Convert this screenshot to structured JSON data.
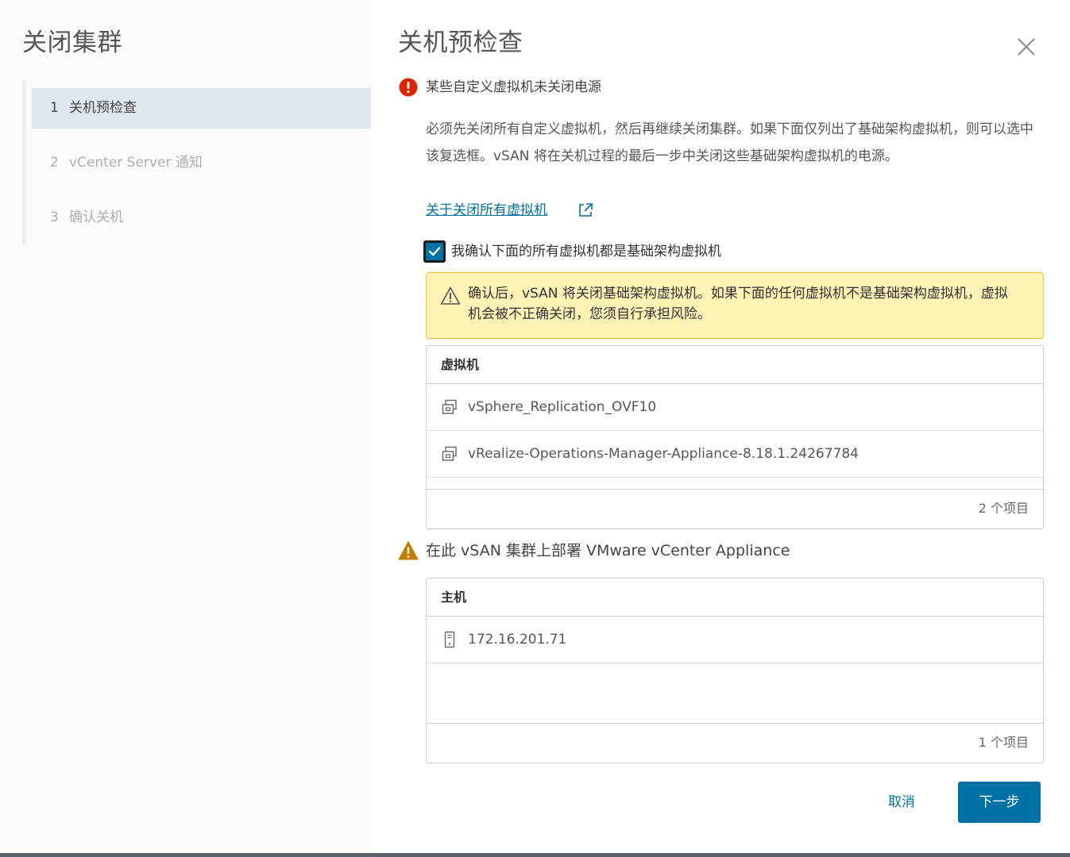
{
  "wizard": {
    "title": "关闭集群",
    "steps": [
      {
        "num": "1",
        "label": "关机预检查",
        "state": "active"
      },
      {
        "num": "2",
        "label": "vCenter Server 通知",
        "state": "pending"
      },
      {
        "num": "3",
        "label": "确认关机",
        "state": "pending"
      }
    ]
  },
  "page": {
    "title": "关机预检查",
    "error_title": "某些自定义虚拟机未关闭电源",
    "description": "必须先关闭所有自定义虚拟机，然后再继续关闭集群。如果下面仅列出了基础架构虚拟机，则可以选中该复选框。vSAN 将在关机过程的最后一步中关闭这些基础架构虚拟机的电源。",
    "link_text": "关于关闭所有虚拟机",
    "confirm_checkbox": {
      "checked": true,
      "label": "我确认下面的所有虚拟机都是基础架构虚拟机"
    },
    "warning_text": "确认后，vSAN 将关闭基础架构虚拟机。如果下面的任何虚拟机不是基础架构虚拟机，虚拟机会被不正确关闭，您须自行承担风险。",
    "vm_grid": {
      "header": "虚拟机",
      "rows": [
        "vSphere_Replication_OVF10",
        "vRealize-Operations-Manager-Appliance-8.18.1.24267784"
      ],
      "footer": "2 个项目"
    },
    "vsan_warning": "在此 vSAN 集群上部署 VMware vCenter Appliance",
    "host_grid": {
      "header": "主机",
      "rows": [
        "172.16.201.71"
      ],
      "footer": "1 个项目"
    },
    "buttons": {
      "cancel": "取消",
      "next": "下一步"
    }
  },
  "colors": {
    "accent": "#0072a3",
    "error": "#e12200",
    "warning": "#c27b00",
    "warning_bg": "#fef3b5",
    "active_step_bg": "#dfe6ed"
  },
  "icons": {
    "close": "close-icon",
    "error": "error-circle-icon",
    "external_link": "external-link-icon",
    "warning": "warning-triangle-icon",
    "vm": "vm-icon",
    "host": "host-icon"
  }
}
